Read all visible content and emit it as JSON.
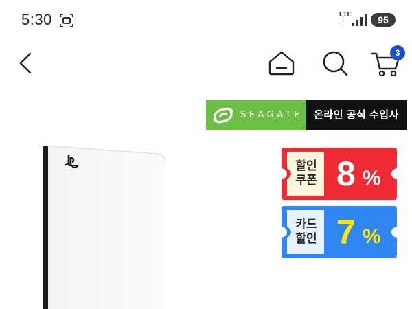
{
  "status_bar": {
    "time": "5:30",
    "network": "LTE",
    "network_arrows": "↓↑",
    "battery": "95"
  },
  "nav": {
    "cart_count": "3"
  },
  "brand_banner": {
    "brand": "SEAGATE",
    "tagline": "온라인 공식 수입사",
    "colors": {
      "brand_green": "#6cbe45",
      "tagline_bg": "#121212"
    }
  },
  "product": {
    "logo": "playstation-logo-icon"
  },
  "coupons": [
    {
      "label_line1": "할인",
      "label_line2": "쿠폰",
      "value": "8",
      "unit": "%",
      "color": "#ee2b34"
    },
    {
      "label_line1": "카드",
      "label_line2": "할인",
      "value": "7",
      "unit": "%",
      "color": "#2f86f0"
    }
  ]
}
